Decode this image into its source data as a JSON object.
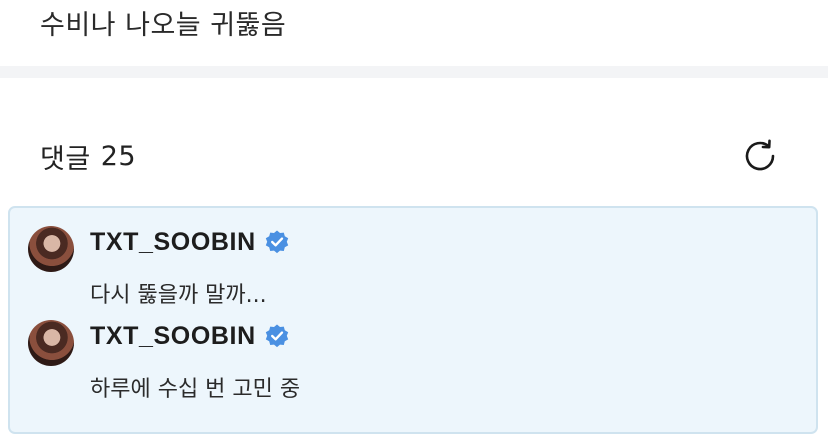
{
  "post": {
    "text": "수비나 나오늘 귀뚫음"
  },
  "comments_section": {
    "label": "댓글",
    "count": "25",
    "refresh_icon": "refresh-icon"
  },
  "comments": [
    {
      "author": "TXT_SOOBIN",
      "verified": true,
      "text": "다시 뚫을까 말까..."
    },
    {
      "author": "TXT_SOOBIN",
      "verified": true,
      "text": "하루에 수십 번 고민 중"
    }
  ],
  "colors": {
    "highlight_background": "#edf6fc",
    "highlight_border": "#cfe3ef",
    "verified_badge": "#4a90e2"
  }
}
